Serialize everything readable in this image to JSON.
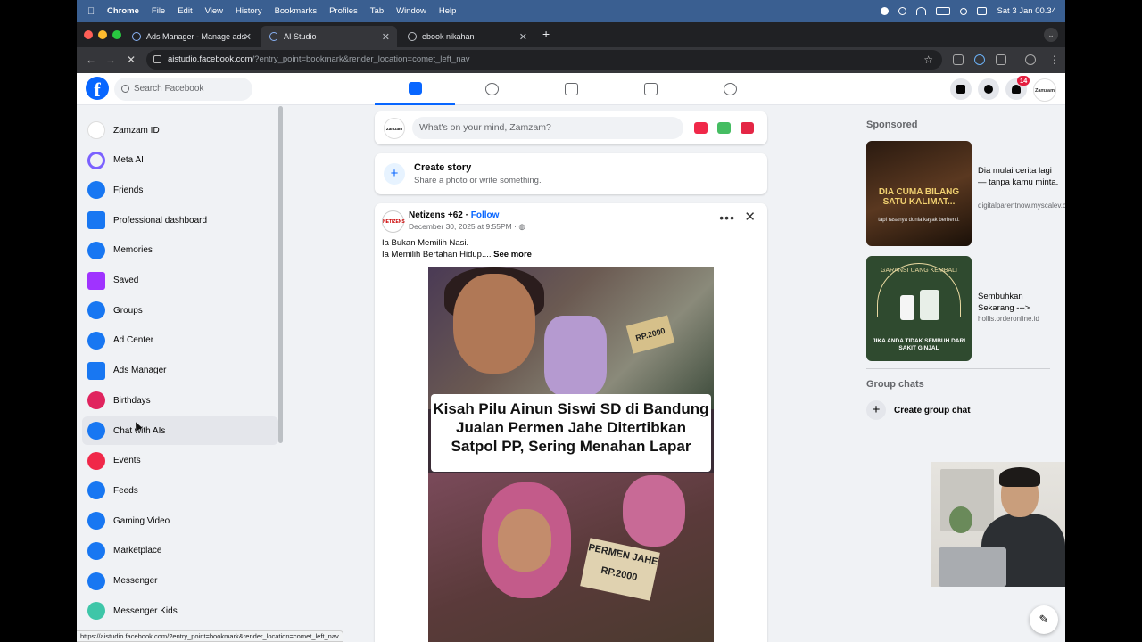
{
  "menubar": {
    "app": "Chrome",
    "items": [
      "File",
      "Edit",
      "View",
      "History",
      "Bookmarks",
      "Profiles",
      "Tab",
      "Window",
      "Help"
    ],
    "clock": "Sat 3 Jan  00.34"
  },
  "tabs": [
    {
      "label": "Ads Manager - Manage ads -",
      "active": false
    },
    {
      "label": "AI Studio",
      "active": true
    },
    {
      "label": "ebook nikahan",
      "active": false
    }
  ],
  "address": {
    "host": "aistudio.facebook.com",
    "path": "/?entry_point=bookmark&render_location=comet_left_nav"
  },
  "header": {
    "search_placeholder": "Search Facebook",
    "notification_count": "14",
    "profile_label": "Zamzam"
  },
  "sidebar": {
    "items": [
      {
        "label": "Zamzam ID",
        "icon": "profile-avatar",
        "color": "#ffffff"
      },
      {
        "label": "Meta AI",
        "icon": "meta-ai-icon",
        "color": "#7b61ff"
      },
      {
        "label": "Friends",
        "icon": "friends-icon",
        "color": "#1877f2"
      },
      {
        "label": "Professional dashboard",
        "icon": "dashboard-icon",
        "color": "#1877f2"
      },
      {
        "label": "Memories",
        "icon": "memories-icon",
        "color": "#1877f2"
      },
      {
        "label": "Saved",
        "icon": "saved-icon",
        "color": "#a033ff"
      },
      {
        "label": "Groups",
        "icon": "groups-icon",
        "color": "#1877f2"
      },
      {
        "label": "Ad Center",
        "icon": "ad-center-icon",
        "color": "#1877f2"
      },
      {
        "label": "Ads Manager",
        "icon": "ads-manager-icon",
        "color": "#1877f2"
      },
      {
        "label": "Birthdays",
        "icon": "birthdays-icon",
        "color": "#e0245e"
      },
      {
        "label": "Chat with AIs",
        "icon": "chat-ai-icon",
        "color": "#1877f2"
      },
      {
        "label": "Events",
        "icon": "events-icon",
        "color": "#f02849"
      },
      {
        "label": "Feeds",
        "icon": "feeds-icon",
        "color": "#1877f2"
      },
      {
        "label": "Gaming Video",
        "icon": "gaming-video-icon",
        "color": "#1877f2"
      },
      {
        "label": "Marketplace",
        "icon": "marketplace-icon",
        "color": "#1877f2"
      },
      {
        "label": "Messenger",
        "icon": "messenger-icon",
        "color": "#1877f2"
      },
      {
        "label": "Messenger Kids",
        "icon": "messenger-kids-icon",
        "color": "#3ec6a8"
      }
    ]
  },
  "composer": {
    "placeholder": "What's on your mind, Zamzam?",
    "avatar_label": "Zamzam"
  },
  "story": {
    "title": "Create story",
    "subtitle": "Share a photo or write something."
  },
  "post": {
    "author": "Netizens +62",
    "separator": " · ",
    "follow": "Follow",
    "date": "December 30, 2025 at 9:55PM · ",
    "line1": "Ia Bukan Memilih Nasi.",
    "line2": "Ia Memilih Bertahan Hidup....",
    "see_more": "See more",
    "banner": "Kisah Pilu Ainun Siswi SD di Bandung Jualan Permen Jahe Ditertibkan Satpol PP, Sering Menahan Lapar",
    "sign_top": "RP.2000",
    "sign_bottom": "PERMEN JAHE RP.2000"
  },
  "right": {
    "sponsored": "Sponsored",
    "ads": [
      {
        "title": "Dia mulai cerita lagi — tanpa kamu minta.",
        "url": "digitalparentnow.myscalev.com",
        "image_headline": "DIA CUMA BILANG SATU KALIMAT...",
        "image_sub": "tapi rasanya dunia kayak berhenti."
      },
      {
        "title": "Sembuhkan Sekarang --->",
        "url": "hollis.orderonline.id",
        "image_headline": "GARANSI UANG KEMBALI",
        "image_sub": "JIKA ANDA TIDAK SEMBUH DARI SAKIT GINJAL"
      }
    ],
    "group_chats": "Group chats",
    "create_group": "Create group chat"
  },
  "status_url": "https://aistudio.facebook.com/?entry_point=bookmark&render_location=comet_left_nav"
}
